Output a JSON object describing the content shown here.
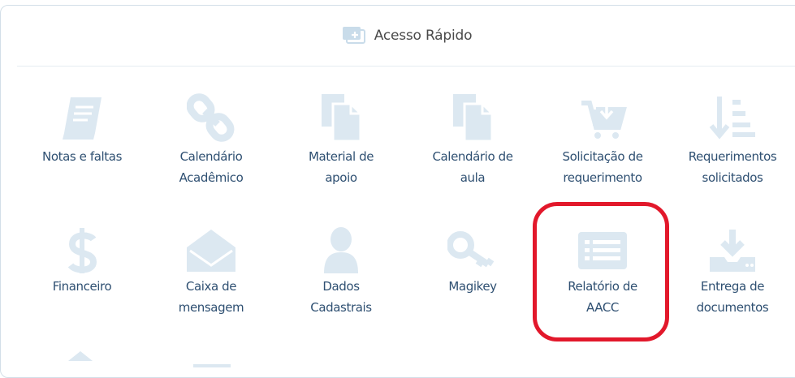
{
  "header": {
    "title": "Acesso Rápido",
    "icon": "screen-share-icon"
  },
  "colors": {
    "icon_fill": "#dce8f1",
    "label": "#2f5072",
    "highlight": "#e2182b",
    "border": "#d3dfe8"
  },
  "tiles": [
    {
      "label": "Notas e faltas",
      "icon": "book-icon"
    },
    {
      "label": "Calendário\nAcadêmico",
      "icon": "chain-link-icon"
    },
    {
      "label": "Material de\napoio",
      "icon": "documents-icon"
    },
    {
      "label": "Calendário de\naula",
      "icon": "documents-icon"
    },
    {
      "label": "Solicitação de\nrequerimento",
      "icon": "cart-download-icon"
    },
    {
      "label": "Requerimentos\nsolicitados",
      "icon": "sort-list-icon"
    },
    {
      "label": "Financeiro",
      "icon": "dollar-icon"
    },
    {
      "label": "Caixa de\nmensagem",
      "icon": "envelope-open-icon"
    },
    {
      "label": "Dados\nCadastrais",
      "icon": "user-icon"
    },
    {
      "label": "Magikey",
      "icon": "key-icon"
    },
    {
      "label": "Relatório de\nAACC",
      "icon": "list-report-icon"
    },
    {
      "label": "Entrega de\ndocumentos",
      "icon": "download-tray-icon"
    }
  ],
  "highlighted_tile": "Relatório de\nAACC"
}
